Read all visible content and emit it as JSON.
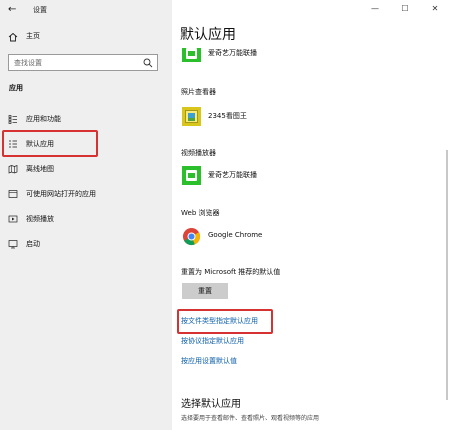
{
  "window": {
    "title": "设置",
    "controls": {
      "minimize": "—",
      "maximize": "☐",
      "close": "✕"
    }
  },
  "sidebar": {
    "home_label": "主页",
    "search": {
      "placeholder": "查找设置"
    },
    "section_label": "应用",
    "items": [
      {
        "label": "应用和功能",
        "icon": "list-icon"
      },
      {
        "label": "默认应用",
        "icon": "default-apps-icon",
        "selected": true
      },
      {
        "label": "离线地图",
        "icon": "map-icon"
      },
      {
        "label": "可使用网站打开的应用",
        "icon": "website-icon"
      },
      {
        "label": "视频播放",
        "icon": "video-icon"
      },
      {
        "label": "启动",
        "icon": "startup-icon"
      }
    ]
  },
  "main": {
    "title": "默认应用",
    "top_app": {
      "name": "爱奇艺万能联播",
      "icon": "iqiyi-icon"
    },
    "photo_viewer": {
      "label": "照片查看器",
      "app": "2345看图王",
      "icon": "photo-viewer-icon"
    },
    "video_player": {
      "label": "视频播放器",
      "app": "爱奇艺万能联播",
      "icon": "iqiyi-icon"
    },
    "web_browser": {
      "label": "Web 浏览器",
      "app": "Google Chrome",
      "icon": "chrome-icon"
    },
    "reset": {
      "label": "重置为 Microsoft 推荐的默认值",
      "button": "重置"
    },
    "links": {
      "by_file_type": "按文件类型指定默认应用",
      "by_protocol": "按协议指定默认应用",
      "by_app": "按应用设置默认值"
    },
    "section": {
      "title": "选择默认应用",
      "description": "选择要用于查看邮件、查看照片、观看视频等的应用"
    }
  },
  "colors": {
    "accent_link": "#0b5ea8",
    "highlight": "#d63232",
    "sidebar_bg": "#efefef",
    "app_green": "#2bbf2b"
  }
}
